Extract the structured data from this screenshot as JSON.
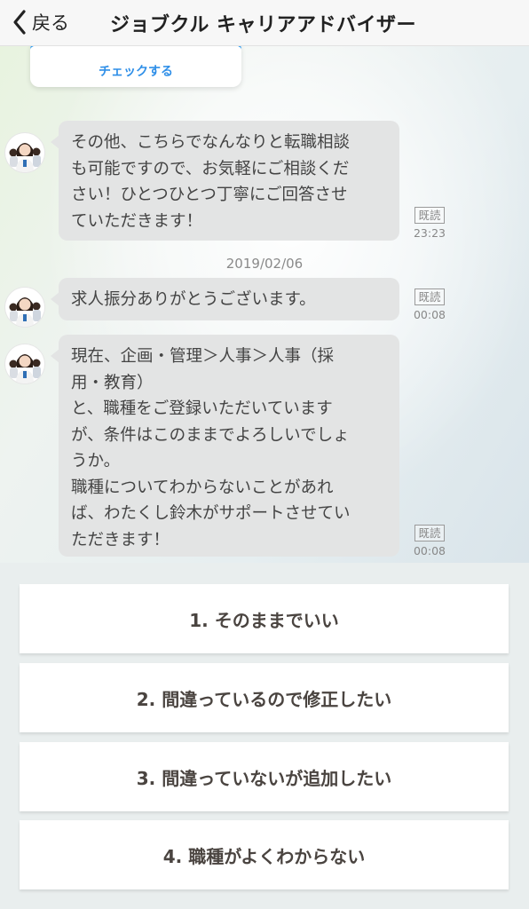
{
  "header": {
    "back_label": "戻る",
    "title": "ジョブクル キャリアアドバイザー"
  },
  "card": {
    "link_label": "チェックする"
  },
  "messages": [
    {
      "text": "その他、こちらでなんなりと転職相談\nも可能ですので、お気軽にご相談くだ\nさい！ひとつひとつ丁寧にご回答させ\nていただきます！",
      "read_label": "既読",
      "time": "23:23"
    },
    {
      "text": "求人振分ありがとうございます。",
      "read_label": "既読",
      "time": "00:08"
    },
    {
      "text": "現在、企画・管理＞人事＞人事（採\n用・教育）\nと、職種をご登録いただいています\nが、条件はこのままでよろしいでしょ\nうか。\n職種についてわからないことがあれ\nば、わたくし鈴木がサポートさせてい\nただきます！",
      "read_label": "既読",
      "time": "00:08"
    }
  ],
  "date_separator": "2019/02/06",
  "options": [
    "1. そのままでいい",
    "2. 間違っているので修正したい",
    "3. 間違っていないが追加したい",
    "4. 職種がよくわからない"
  ],
  "colors": {
    "accent": "#2f9bf0",
    "bubble": "#e3e4e4",
    "option_text": "#4a4440"
  },
  "icons": {
    "back": "chevron-left-icon",
    "avatar": "advisor-avatar-icon"
  }
}
